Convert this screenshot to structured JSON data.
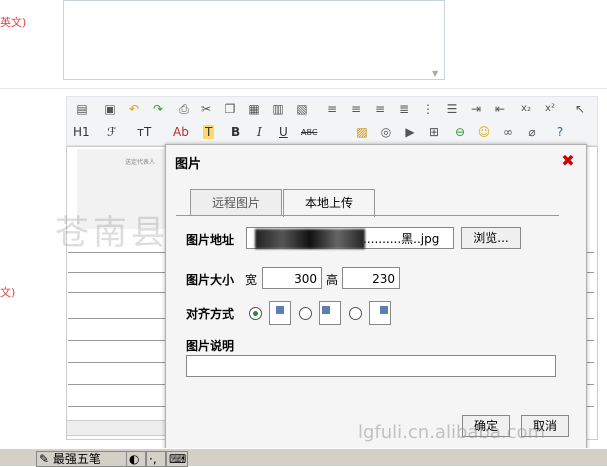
{
  "left_panel": {
    "label1": "英文)",
    "label2": "文)"
  },
  "toolbar": {
    "heading_label": "H1",
    "font_label": "ℱ",
    "size_label": "тT",
    "color_label": "Ab",
    "highlight_label": "T",
    "bold_label": "B",
    "italic_label": "I",
    "underline_label": "U",
    "strike_label": "ABC"
  },
  "preview_caption": "送定代表人",
  "dialog": {
    "title": "图片",
    "tabs": [
      {
        "label": "远程图片"
      },
      {
        "label": "本地上传"
      }
    ],
    "address_label": "图片地址",
    "address_value": "..........黑..jpg",
    "browse_label": "浏览...",
    "size_label": "图片大小",
    "width_label": "宽",
    "width_value": "300",
    "height_label": "高",
    "height_value": "230",
    "align_label": "对齐方式",
    "desc_label": "图片说明",
    "desc_value": "",
    "ok_label": "确定",
    "cancel_label": "取消"
  },
  "watermark": "苍南县福利彩票营业部",
  "site_watermark": "lgfuli.cn.alibaba.com",
  "taskbar": {
    "item1": "最强五笔"
  }
}
